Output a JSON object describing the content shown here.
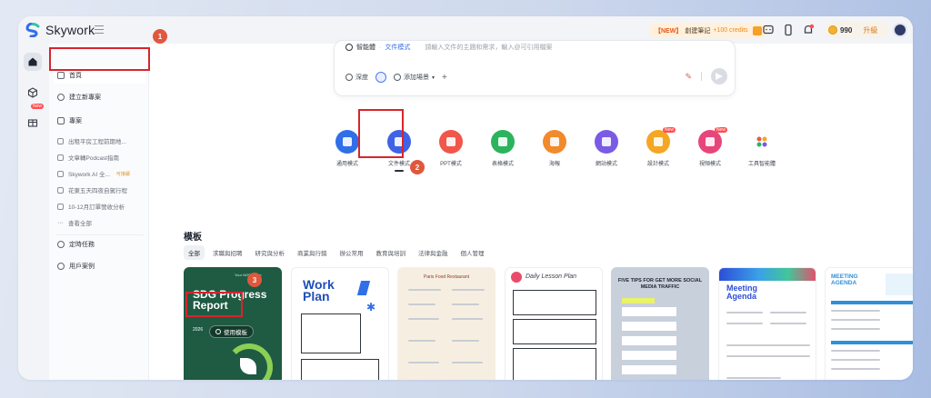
{
  "app": {
    "name": "Skywork"
  },
  "topbar": {
    "new_tag": "【NEW】",
    "new_text": "創建筆記",
    "new_credits": "+100 credits",
    "credits": "990",
    "upgrade": "升級"
  },
  "rail": {
    "new_badge": "New"
  },
  "sidebar": {
    "items": [
      {
        "label": "首頁"
      },
      {
        "label": "建立新專案"
      },
      {
        "label": "專案"
      }
    ],
    "history": [
      {
        "label": "出租平房工程前期地..."
      },
      {
        "label": "文章轉Podcast指南"
      },
      {
        "label": "Skywork AI 全...",
        "badge": "可接續"
      },
      {
        "label": "花東五天四夜自駕行程"
      },
      {
        "label": "10-12月訂單營收分析"
      }
    ],
    "view_all": "查看全部",
    "scheduled": "定時任務",
    "cases": "用戶案例"
  },
  "input": {
    "mode_general": "智能體",
    "mode_active": "文件模式",
    "placeholder": "請輸入文件的主題和需求，輸入@可引用檔案",
    "deep": "深度",
    "scenario": "添加場景"
  },
  "modes": [
    {
      "label": "通用模式",
      "color": "#2f6fe8"
    },
    {
      "label": "文件模式",
      "color": "#3f63e6"
    },
    {
      "label": "PPT模式",
      "color": "#f0564a"
    },
    {
      "label": "表格模式",
      "color": "#2cb35e"
    },
    {
      "label": "海報",
      "color": "#f28a2c"
    },
    {
      "label": "網站模式",
      "color": "#7a5be6"
    },
    {
      "label": "設計模式",
      "color": "#f5a623",
      "badge": "New"
    },
    {
      "label": "視頻模式",
      "color": "#e8457a",
      "badge": "New"
    },
    {
      "label": "工具智能體",
      "color": "#ffffff"
    }
  ],
  "templates": {
    "title": "模板",
    "categories": [
      "全部",
      "求職與招聘",
      "研究與分析",
      "商業與行銷",
      "辦公常用",
      "教育與培訓",
      "法律與金融",
      "個人管理"
    ],
    "use_button": "使用模板",
    "cards": [
      {
        "org": "Your NGP Name",
        "title": "SDG Progress Report",
        "year": "2026"
      },
      {
        "title_a": "Work",
        "title_b": "Plan"
      },
      {
        "title": "Paris Food Restaurant"
      },
      {
        "title": "Daily Lesson Plan"
      },
      {
        "title": "FIVE TIPS FOR GET MORE SOCIAL MEDIA TRAFFIC"
      },
      {
        "title": "Meeting Agenda"
      },
      {
        "title": "MEETING AGENDA"
      }
    ]
  },
  "annotations": [
    "1",
    "2",
    "3"
  ]
}
